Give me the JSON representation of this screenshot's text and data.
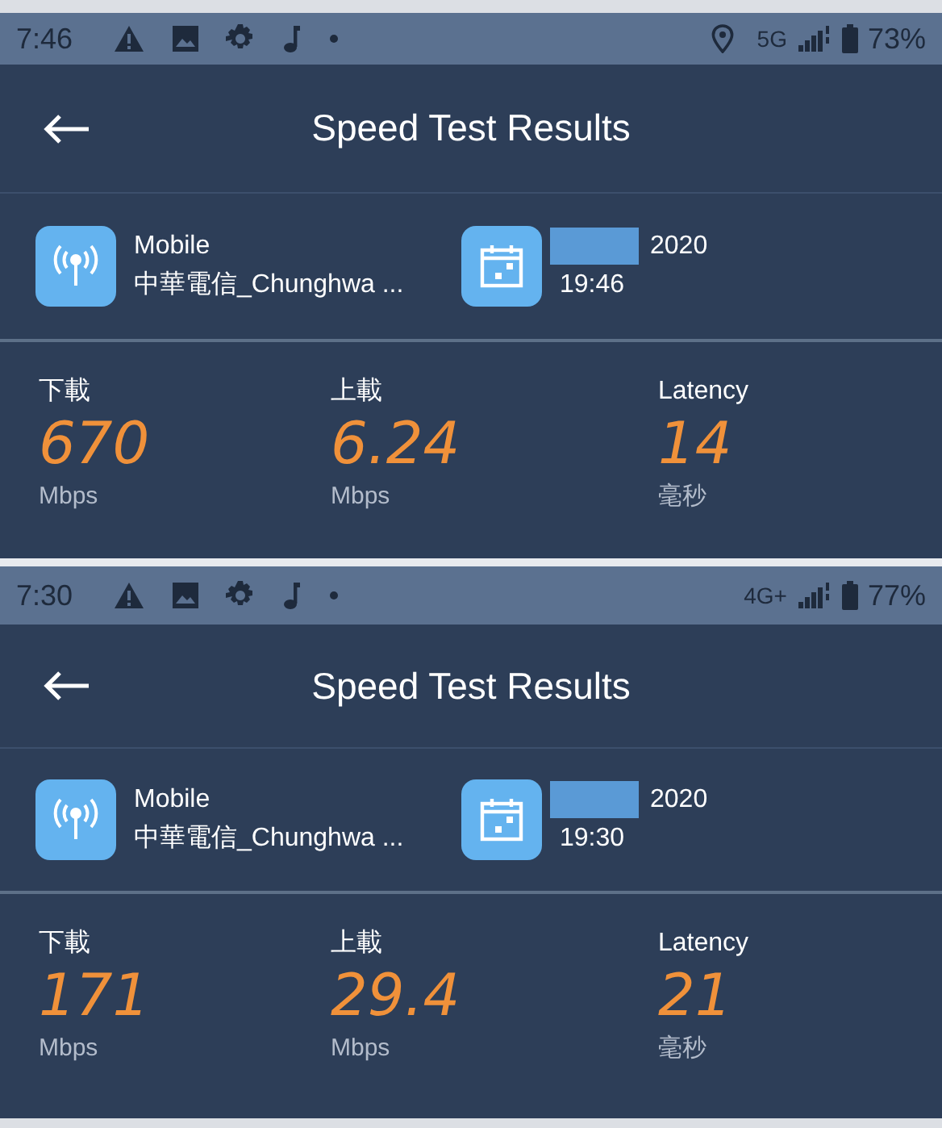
{
  "panels": [
    {
      "status_bar": {
        "time": "7:46",
        "location": true,
        "network": "5G",
        "battery": "73%"
      },
      "header": {
        "title": "Speed Test Results"
      },
      "connection": {
        "type": "Mobile",
        "carrier": "中華電信_Chunghwa ..."
      },
      "date": {
        "year": "2020",
        "time": "19:46"
      },
      "metrics": [
        {
          "label": "下載",
          "value": "670",
          "unit": "Mbps"
        },
        {
          "label": "上載",
          "value": "6.24",
          "unit": "Mbps"
        },
        {
          "label": "Latency",
          "value": "14",
          "unit": "毫秒"
        }
      ]
    },
    {
      "status_bar": {
        "time": "7:30",
        "location": false,
        "network": "4G+",
        "battery": "77%"
      },
      "header": {
        "title": "Speed Test Results"
      },
      "connection": {
        "type": "Mobile",
        "carrier": "中華電信_Chunghwa ..."
      },
      "date": {
        "year": "2020",
        "time": "19:30"
      },
      "metrics": [
        {
          "label": "下載",
          "value": "171",
          "unit": "Mbps"
        },
        {
          "label": "上載",
          "value": "29.4",
          "unit": "Mbps"
        },
        {
          "label": "Latency",
          "value": "21",
          "unit": "毫秒"
        }
      ]
    }
  ]
}
